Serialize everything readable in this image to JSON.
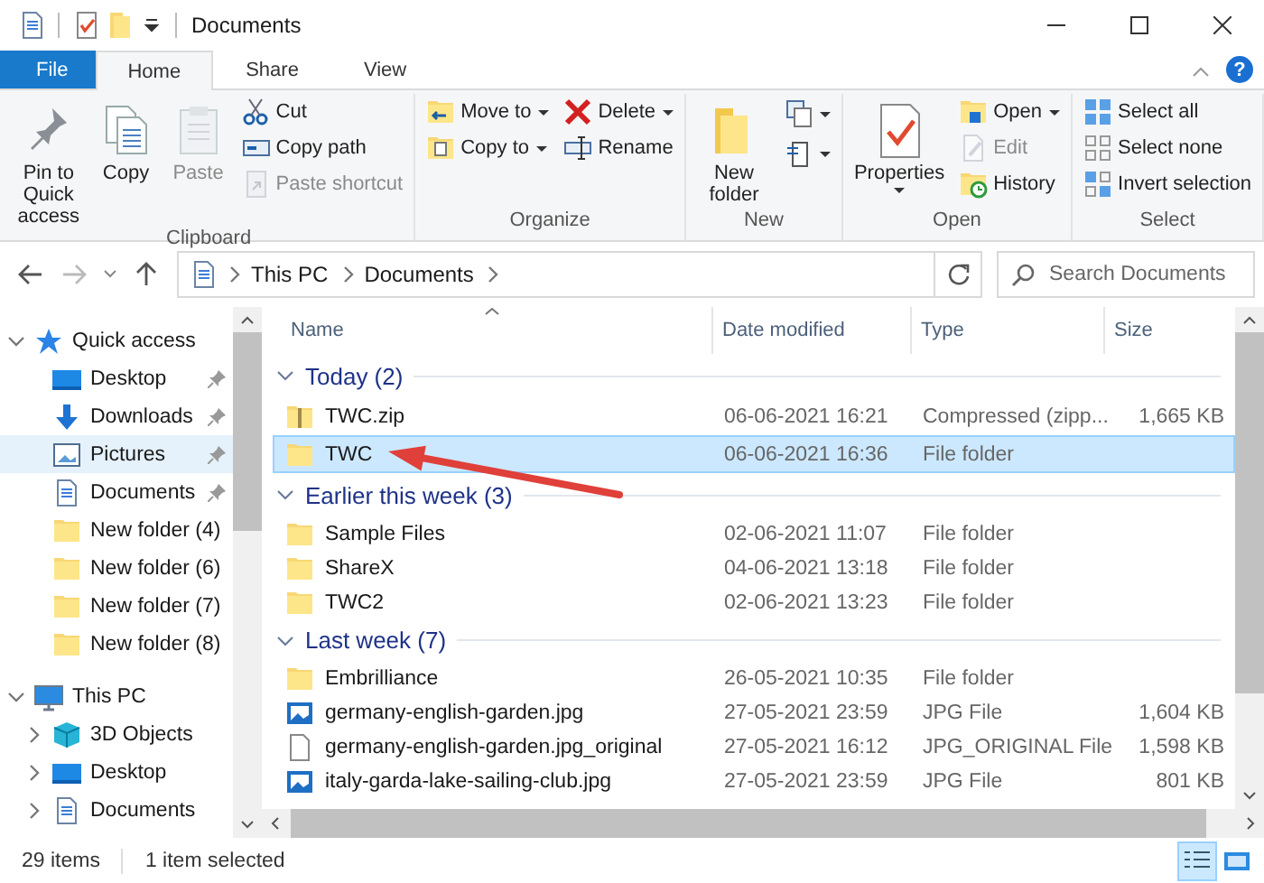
{
  "window": {
    "title": "Documents"
  },
  "ribbon_tabs": [
    {
      "label": "File",
      "kind": "file",
      "selected": false
    },
    {
      "label": "Home",
      "kind": "tab",
      "selected": true
    },
    {
      "label": "Share",
      "kind": "tab",
      "selected": false
    },
    {
      "label": "View",
      "kind": "tab",
      "selected": false
    }
  ],
  "help": {
    "symbol": "?"
  },
  "ribbon_groups": [
    {
      "label": "Clipboard",
      "columns": [
        [
          {
            "kind": "large",
            "label": "Pin to Quick access",
            "disabled": false,
            "dropdown": false
          }
        ],
        [
          {
            "kind": "large",
            "label": "Copy",
            "disabled": false,
            "dropdown": false
          }
        ],
        [
          {
            "kind": "large",
            "label": "Paste",
            "disabled": true,
            "dropdown": false
          }
        ],
        [
          {
            "kind": "small",
            "label": "Cut",
            "disabled": false,
            "dropdown": false
          },
          {
            "kind": "small",
            "label": "Copy path",
            "disabled": false,
            "dropdown": false
          },
          {
            "kind": "small",
            "label": "Paste shortcut",
            "disabled": true,
            "dropdown": false
          }
        ]
      ]
    },
    {
      "label": "Organize",
      "columns": [
        [
          {
            "kind": "small",
            "label": "Move to",
            "disabled": false,
            "dropdown": true
          },
          {
            "kind": "small",
            "label": "Copy to",
            "disabled": false,
            "dropdown": true
          }
        ],
        [
          {
            "kind": "small",
            "label": "Delete",
            "disabled": false,
            "dropdown": true
          },
          {
            "kind": "small",
            "label": "Rename",
            "disabled": false,
            "dropdown": false
          }
        ]
      ]
    },
    {
      "label": "New",
      "columns": [
        [
          {
            "kind": "large",
            "label": "New folder",
            "disabled": false,
            "dropdown": false
          }
        ],
        [
          {
            "kind": "icon",
            "disabled": false,
            "dropdown": true
          },
          {
            "kind": "icon",
            "disabled": false,
            "dropdown": true
          }
        ]
      ]
    },
    {
      "label": "Open",
      "columns": [
        [
          {
            "kind": "large",
            "label": "Properties",
            "disabled": false,
            "dropdown": true
          }
        ],
        [
          {
            "kind": "small",
            "label": "Open",
            "disabled": false,
            "dropdown": true
          },
          {
            "kind": "small",
            "label": "Edit",
            "disabled": true,
            "dropdown": false
          },
          {
            "kind": "small",
            "label": "History",
            "disabled": false,
            "dropdown": false
          }
        ]
      ]
    },
    {
      "label": "Select",
      "columns": [
        [
          {
            "kind": "small",
            "label": "Select all",
            "disabled": false,
            "dropdown": false
          },
          {
            "kind": "small",
            "label": "Select none",
            "disabled": false,
            "dropdown": false
          },
          {
            "kind": "small",
            "label": "Invert selection",
            "disabled": false,
            "dropdown": false
          }
        ]
      ]
    }
  ],
  "address_bar": {
    "path": [
      "This PC",
      "Documents"
    ]
  },
  "search": {
    "placeholder": "Search Documents"
  },
  "navigation": [
    {
      "label": "Quick access",
      "kind": "star",
      "expanded": true,
      "selected": false,
      "children": [
        {
          "label": "Desktop",
          "kind": "desktop",
          "pinned": true,
          "selected": false
        },
        {
          "label": "Downloads",
          "kind": "download",
          "pinned": true,
          "selected": false
        },
        {
          "label": "Pictures",
          "kind": "pictures",
          "pinned": true,
          "selected": true
        },
        {
          "label": "Documents",
          "kind": "document",
          "pinned": true,
          "selected": false
        },
        {
          "label": "New folder (4)",
          "kind": "folder",
          "pinned": false,
          "selected": false
        },
        {
          "label": "New folder (6)",
          "kind": "folder",
          "pinned": false,
          "selected": false
        },
        {
          "label": "New folder (7)",
          "kind": "folder",
          "pinned": false,
          "selected": false
        },
        {
          "label": "New folder (8)",
          "kind": "folder",
          "pinned": false,
          "selected": false
        }
      ]
    },
    {
      "label": "This PC",
      "kind": "pc",
      "expanded": true,
      "selected": false,
      "children": [
        {
          "label": "3D Objects",
          "kind": "cube",
          "expanded": false,
          "selected": false
        },
        {
          "label": "Desktop",
          "kind": "desktop",
          "expanded": false,
          "selected": false
        },
        {
          "label": "Documents",
          "kind": "document",
          "expanded": false,
          "selected": false
        }
      ]
    }
  ],
  "columns": [
    "Name",
    "Date modified",
    "Type",
    "Size"
  ],
  "file_groups": [
    {
      "label": "Today (2)",
      "rows": [
        {
          "kind": "zip",
          "name": "TWC.zip",
          "date": "06-06-2021 16:21",
          "type": "Compressed (zipp...",
          "size": "1,665 KB",
          "selected": false
        },
        {
          "kind": "folder",
          "name": "TWC",
          "date": "06-06-2021 16:36",
          "type": "File folder",
          "selected": true
        }
      ]
    },
    {
      "label": "Earlier this week (3)",
      "rows": [
        {
          "kind": "folder",
          "name": "Sample Files",
          "date": "02-06-2021 11:07",
          "type": "File folder",
          "selected": false
        },
        {
          "kind": "folder",
          "name": "ShareX",
          "date": "04-06-2021 13:18",
          "type": "File folder",
          "selected": false
        },
        {
          "kind": "folder",
          "name": "TWC2",
          "date": "02-06-2021 13:23",
          "type": "File folder",
          "selected": false
        }
      ]
    },
    {
      "label": "Last week (7)",
      "rows": [
        {
          "kind": "folder",
          "name": "Embrilliance",
          "date": "26-05-2021 10:35",
          "type": "File folder",
          "selected": false
        },
        {
          "kind": "image",
          "name": "germany-english-garden.jpg",
          "date": "27-05-2021 23:59",
          "type": "JPG File",
          "size": "1,604 KB",
          "selected": false
        },
        {
          "kind": "file",
          "name": "germany-english-garden.jpg_original",
          "date": "27-05-2021 16:12",
          "type": "JPG_ORIGINAL File",
          "size": "1,598 KB",
          "selected": false
        },
        {
          "kind": "image",
          "name": "italy-garda-lake-sailing-club.jpg",
          "date": "27-05-2021 23:59",
          "type": "JPG File",
          "size": "801 KB",
          "selected": false
        }
      ]
    }
  ],
  "status_bar": {
    "count": "29 items",
    "selection": "1 item selected"
  },
  "view_buttons": [
    {
      "kind": "details",
      "selected": true
    },
    {
      "kind": "tiles",
      "selected": false
    }
  ]
}
